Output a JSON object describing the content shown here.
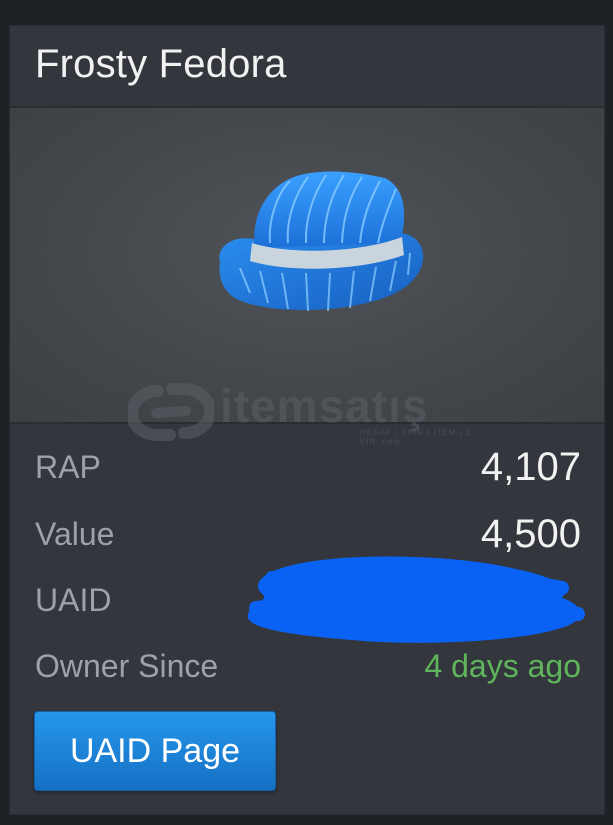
{
  "item": {
    "name": "Frosty Fedora"
  },
  "stats": {
    "rap_label": "RAP",
    "rap_value": "4,107",
    "value_label": "Value",
    "value_value": "4,500",
    "uaid_label": "UAID",
    "owner_label": "Owner Since",
    "owner_value": "4 days ago"
  },
  "watermark": {
    "text": "itemsatış",
    "subtext": "HESAP | SKIN | ITEM | E-PIN .com"
  },
  "buttons": {
    "uaid_page": "UAID Page"
  },
  "colors": {
    "card_bg": "#33363c",
    "accent_button": "#1f86dc",
    "owner_since_green": "#5fb55b",
    "scribble_blue": "#0a62f5"
  }
}
